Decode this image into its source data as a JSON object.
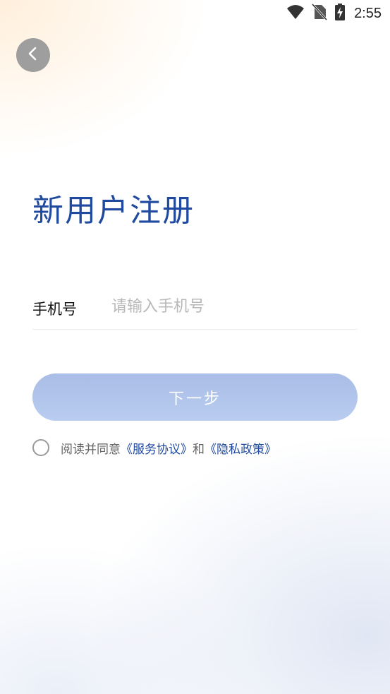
{
  "status_bar": {
    "time": "2:55",
    "icons": [
      "wifi-icon",
      "no-sim-icon",
      "battery-charging-icon"
    ]
  },
  "header": {
    "back_icon": "chevron-left-icon"
  },
  "main": {
    "title": "新用户注册",
    "phone": {
      "label": "手机号",
      "value": "",
      "placeholder": "请输入手机号"
    },
    "next_button": "下一步",
    "agreement": {
      "prefix": "阅读并同意",
      "service_link": "《服务协议》",
      "conjunction": "和",
      "privacy_link": "《隐私政策》",
      "checked": false
    }
  },
  "colors": {
    "accent": "#1f4aa0",
    "button_bg": "#b1c4eb",
    "back_button_bg": "#9e9e9e"
  }
}
